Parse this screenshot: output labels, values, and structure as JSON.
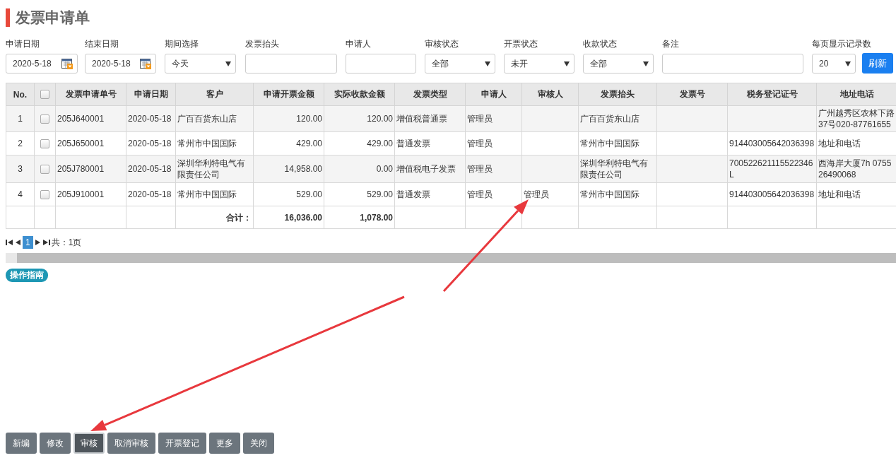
{
  "title": "发票申请单",
  "filters": [
    {
      "kind": "date",
      "label": "申请日期",
      "value": "2020-5-18"
    },
    {
      "kind": "date",
      "label": "结束日期",
      "value": "2020-5-18"
    },
    {
      "kind": "select",
      "label": "期间选择",
      "value": "今天"
    },
    {
      "kind": "text",
      "label": "发票抬头"
    },
    {
      "kind": "text",
      "label": "申请人"
    },
    {
      "kind": "select",
      "label": "审核状态",
      "value": "全部"
    },
    {
      "kind": "select",
      "label": "开票状态",
      "value": "未开"
    },
    {
      "kind": "select",
      "label": "收款状态",
      "value": "全部"
    },
    {
      "kind": "text",
      "label": "备注"
    },
    {
      "kind": "select",
      "label": "每页显示记录数",
      "value": "20"
    }
  ],
  "refresh_button": "刷新",
  "table": {
    "columns": [
      "No.",
      "发票申请单号",
      "申请日期",
      "客户",
      "申请开票金额",
      "实际收款金额",
      "发票类型",
      "申请人",
      "审核人",
      "发票抬头",
      "发票号",
      "税务登记证号",
      "地址电话"
    ],
    "header_checked": false,
    "rows": [
      {
        "checked": false,
        "cells": [
          "1",
          "205J640001",
          "2020-05-18",
          "广百百货东山店",
          "120.00",
          "120.00",
          "增值税普通票",
          "管理员",
          null,
          "广百百货东山店",
          null,
          null,
          "广州越秀区农林下路37号020-87761655"
        ]
      },
      {
        "checked": false,
        "cells": [
          "2",
          "205J650001",
          "2020-05-18",
          "常州市中国国际",
          "429.00",
          "429.00",
          "普通发票",
          "管理员",
          null,
          "常州市中国国际",
          null,
          "914403005642036398",
          "地址和电话"
        ]
      },
      {
        "checked": false,
        "cells": [
          "3",
          "205J780001",
          "2020-05-18",
          "深圳华利特电气有限责任公司",
          "14,958.00",
          "0.00",
          "增值税电子发票",
          "管理员",
          null,
          "深圳华利特电气有限责任公司",
          null,
          "700522621115522346L",
          "西海岸大厦7h 075526490068"
        ]
      },
      {
        "checked": false,
        "cells": [
          "4",
          "205J910001",
          "2020-05-18",
          "常州市中国国际",
          "529.00",
          "529.00",
          "普通发票",
          "管理员",
          "管理员",
          "常州市中国国际",
          null,
          "914403005642036398",
          "地址和电话"
        ]
      }
    ],
    "summary": {
      "label": "合计：",
      "requested_total": "16,036.00",
      "received_total": "1,078.00"
    }
  },
  "pagination": {
    "pages": [
      {
        "label": "1",
        "selected": true
      }
    ],
    "total": "共：1页"
  },
  "guide_badge": "操作指南",
  "buttons": [
    {
      "label": "新编",
      "selected": false
    },
    {
      "label": "修改",
      "selected": false
    },
    {
      "label": "审核",
      "selected": true
    },
    {
      "label": "取消审核",
      "selected": false
    },
    {
      "label": "开票登记",
      "selected": false
    },
    {
      "label": "更多",
      "selected": false
    },
    {
      "label": "关闭",
      "selected": false
    }
  ]
}
